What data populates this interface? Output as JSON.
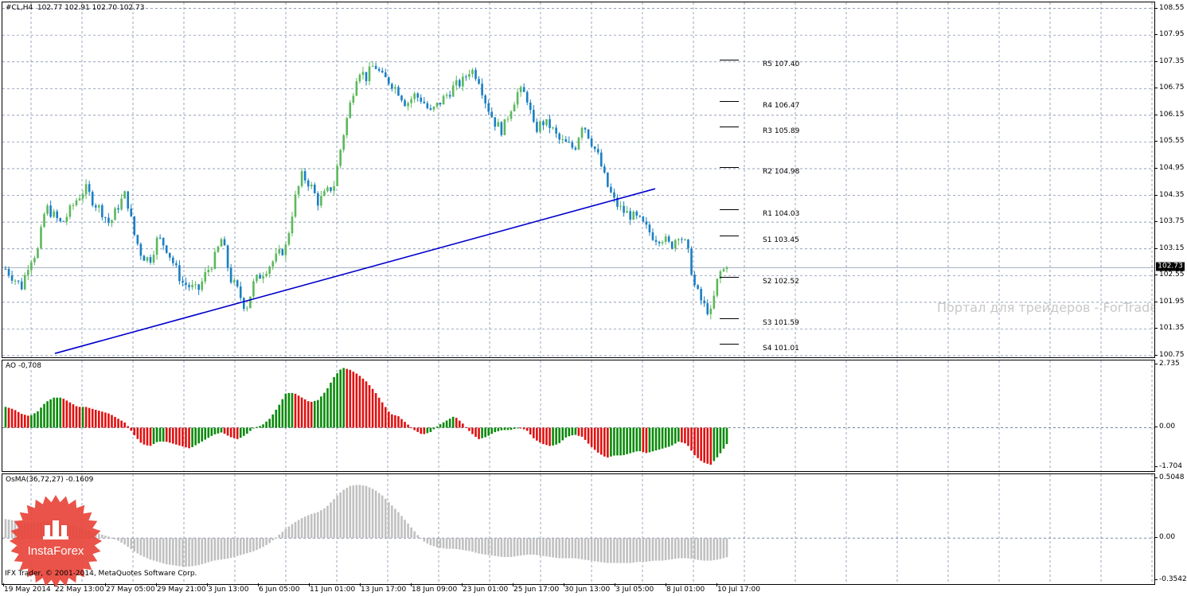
{
  "symbol_info": "#CL,H4  102.77 102.91 102.70 102.73",
  "colors": {
    "bull": "#5cb85c",
    "bear": "#1a7fc4",
    "trendline": "#0000cc",
    "grid": "#6f7fa0",
    "ao_up": "#0a8a0a",
    "ao_down": "#e01010",
    "osma": "#c0c0c0",
    "pricebox": "#000000"
  },
  "panels": {
    "ao_title": "AO -0,708",
    "osma_title": "OsMA(36,72,27) -0.1609"
  },
  "pivots": [
    {
      "label": "R5 107.40",
      "value": 107.4
    },
    {
      "label": "R4 106.47",
      "value": 106.47
    },
    {
      "label": "R3 105.89",
      "value": 105.89
    },
    {
      "label": "R2 104.98",
      "value": 104.98
    },
    {
      "label": "R1 104.03",
      "value": 104.03
    },
    {
      "label": "S1 103.45",
      "value": 103.45
    },
    {
      "label": "S2 102.52",
      "value": 102.52
    },
    {
      "label": "S3 101.59",
      "value": 101.59
    },
    {
      "label": "S4 101.01",
      "value": 101.01
    }
  ],
  "current_price": "102.73",
  "watermark": "Портал для трейдеров - ForTrader.ru",
  "copyright": "IFX Trader, © 2001-2014, MetaQuotes Software Corp.",
  "logo_text": "InstaForex",
  "chart_data": [
    {
      "type": "line",
      "subtype": "candlestick",
      "title": "#CL,H4",
      "ylim": [
        100.75,
        108.65
      ],
      "y_ticks": [
        "108.55",
        "107.95",
        "107.35",
        "106.75",
        "106.15",
        "105.55",
        "104.95",
        "104.35",
        "103.75",
        "103.15",
        "102.55",
        "101.95",
        "101.35",
        "100.75"
      ],
      "x_ticks": [
        "19 May 2014",
        "22 May 13:00",
        "27 May 05:00",
        "29 May 21:00",
        "3 Jun 13:00",
        "6 Jun 05:00",
        "11 Jun 01:00",
        "13 Jun 17:00",
        "18 Jun 09:00",
        "23 Jun 01:00",
        "25 Jun 17:00",
        "30 Jun 13:00",
        "3 Jul 05:00",
        "8 Jul 01:00",
        "10 Jul 17:00"
      ],
      "series": [
        {
          "values": [
            102.7,
            102.5,
            102.3,
            102.9,
            103.1,
            104.1,
            103.9,
            103.7,
            104.0,
            104.3,
            104.5,
            104.2,
            104.0,
            103.7,
            104.1,
            104.4,
            103.5,
            103.0,
            102.9,
            103.4,
            103.2,
            102.8,
            102.4,
            102.3,
            102.2,
            102.6,
            102.9,
            103.4,
            102.5,
            102.2,
            101.8,
            102.4,
            102.6,
            102.8,
            103.0,
            103.2,
            104.2,
            104.8,
            104.6,
            104.2,
            104.4,
            104.6,
            105.6,
            106.4,
            107.2,
            107.0,
            107.3,
            107.0,
            106.9,
            106.7,
            106.4,
            106.6,
            106.5,
            106.2,
            106.4,
            106.6,
            106.8,
            106.9,
            107.2,
            107.0,
            106.4,
            106.0,
            105.8,
            106.3,
            106.7,
            106.6,
            105.8,
            106.0,
            105.9,
            105.6,
            105.5,
            105.4,
            106.0,
            105.6,
            105.2,
            104.6,
            104.2,
            104.0,
            103.9,
            103.8,
            103.6,
            103.4,
            103.4,
            103.2,
            103.5,
            103.2,
            102.3,
            101.9,
            101.7,
            102.6,
            102.73
          ]
        }
      ],
      "trendline": {
        "start": [
          "22 May 13:00",
          100.8
        ],
        "end": [
          "3 Jul 05:00",
          104.5
        ]
      }
    },
    {
      "type": "bar",
      "title": "AO -0,708",
      "ylim": [
        -1.704,
        2.735
      ],
      "y_ticks": [
        "2.735",
        "0.00",
        "-1.704"
      ],
      "series": [
        {
          "name": "AO",
          "values": [
            0.9,
            0.8,
            0.6,
            0.5,
            0.7,
            1.1,
            1.3,
            1.3,
            1.1,
            0.9,
            0.9,
            0.8,
            0.7,
            0.6,
            0.4,
            0.2,
            -0.3,
            -0.7,
            -0.8,
            -0.6,
            -0.6,
            -0.7,
            -0.8,
            -0.9,
            -0.7,
            -0.5,
            -0.3,
            -0.2,
            -0.4,
            -0.5,
            -0.3,
            0.0,
            0.1,
            0.4,
            0.9,
            1.5,
            1.5,
            1.3,
            1.1,
            1.2,
            1.6,
            2.2,
            2.6,
            2.5,
            2.3,
            2.0,
            1.6,
            1.1,
            0.6,
            0.5,
            0.2,
            -0.1,
            -0.3,
            -0.2,
            0.1,
            0.3,
            0.5,
            0.2,
            -0.2,
            -0.5,
            -0.4,
            -0.2,
            -0.1,
            -0.1,
            0.0,
            -0.1,
            -0.5,
            -0.7,
            -0.8,
            -0.7,
            -0.4,
            -0.3,
            -0.4,
            -0.8,
            -1.1,
            -1.3,
            -1.2,
            -1.2,
            -1.1,
            -1.0,
            -1.1,
            -1.0,
            -0.9,
            -0.8,
            -0.6,
            -0.7,
            -1.2,
            -1.5,
            -1.6,
            -1.2,
            -0.708
          ]
        }
      ]
    },
    {
      "type": "bar",
      "title": "OsMA(36,72,27) -0.1609",
      "ylim": [
        -0.3542,
        0.5048
      ],
      "y_ticks": [
        "0.5048",
        "0.00",
        "-0.3542"
      ],
      "series": [
        {
          "name": "OsMA",
          "values": [
            0.16,
            0.15,
            0.13,
            0.12,
            0.13,
            0.14,
            0.14,
            0.13,
            0.11,
            0.09,
            0.07,
            0.05,
            0.03,
            0.01,
            -0.02,
            -0.06,
            -0.11,
            -0.15,
            -0.18,
            -0.2,
            -0.22,
            -0.23,
            -0.24,
            -0.24,
            -0.23,
            -0.21,
            -0.19,
            -0.18,
            -0.17,
            -0.15,
            -0.13,
            -0.11,
            -0.08,
            -0.04,
            0.02,
            0.08,
            0.13,
            0.17,
            0.2,
            0.22,
            0.26,
            0.33,
            0.4,
            0.44,
            0.45,
            0.44,
            0.41,
            0.36,
            0.29,
            0.22,
            0.14,
            0.06,
            -0.02,
            -0.06,
            -0.08,
            -0.09,
            -0.09,
            -0.1,
            -0.11,
            -0.13,
            -0.14,
            -0.15,
            -0.16,
            -0.16,
            -0.15,
            -0.14,
            -0.14,
            -0.15,
            -0.16,
            -0.17,
            -0.17,
            -0.17,
            -0.18,
            -0.19,
            -0.2,
            -0.21,
            -0.21,
            -0.21,
            -0.21,
            -0.2,
            -0.2,
            -0.19,
            -0.19,
            -0.18,
            -0.17,
            -0.17,
            -0.18,
            -0.19,
            -0.19,
            -0.18,
            -0.1609
          ]
        }
      ]
    }
  ]
}
